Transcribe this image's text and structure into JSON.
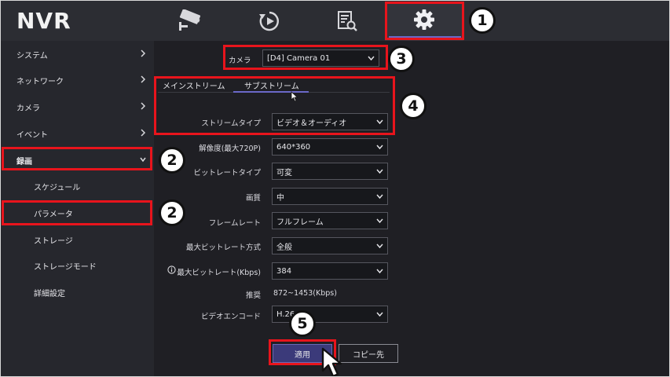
{
  "app": {
    "logo": "NVR"
  },
  "topnav": {
    "items": [
      {
        "icon": "camera-icon"
      },
      {
        "icon": "playback-icon"
      },
      {
        "icon": "search-file-icon"
      },
      {
        "icon": "gear-icon",
        "active": true
      }
    ]
  },
  "sidebar": {
    "items": [
      {
        "label": "システム"
      },
      {
        "label": "ネットワーク"
      },
      {
        "label": "カメラ"
      },
      {
        "label": "イベント"
      },
      {
        "label": "録画"
      },
      {
        "label": "スケジュール"
      },
      {
        "label": "パラメータ"
      },
      {
        "label": "ストレージ"
      },
      {
        "label": "ストレージモード"
      },
      {
        "label": "詳細設定"
      }
    ]
  },
  "camera": {
    "label": "カメラ",
    "value": "[D4] Camera 01"
  },
  "tabs": [
    {
      "label": "メインストリーム"
    },
    {
      "label": "サブストリーム",
      "active": true
    }
  ],
  "form": {
    "stream_type": {
      "label": "ストリームタイプ",
      "value": "ビデオ＆オーディオ"
    },
    "resolution": {
      "label": "解像度(最大720P)",
      "value": "640*360"
    },
    "bitrate_type": {
      "label": "ビットレートタイプ",
      "value": "可変"
    },
    "quality": {
      "label": "画質",
      "value": "中"
    },
    "frame_rate": {
      "label": "フレームレート",
      "value": "フルフレーム"
    },
    "max_bitrate_mode": {
      "label": "最大ビットレート方式",
      "value": "全般"
    },
    "max_bitrate": {
      "label": "最大ビットレート(Kbps)",
      "value": "384"
    },
    "recommended": {
      "label": "推奨",
      "value": "872~1453(Kbps)"
    },
    "video_encode": {
      "label": "ビデオエンコード",
      "value": "H.26"
    }
  },
  "buttons": {
    "apply": "適用",
    "copy": "コピー先"
  },
  "annotations": {
    "n1": "1",
    "n2": "2",
    "n3": "3",
    "n4": "4",
    "n5": "5"
  },
  "colors": {
    "accent": "#6b69c8",
    "highlight": "#e8141c",
    "background": "#1f1f24"
  }
}
